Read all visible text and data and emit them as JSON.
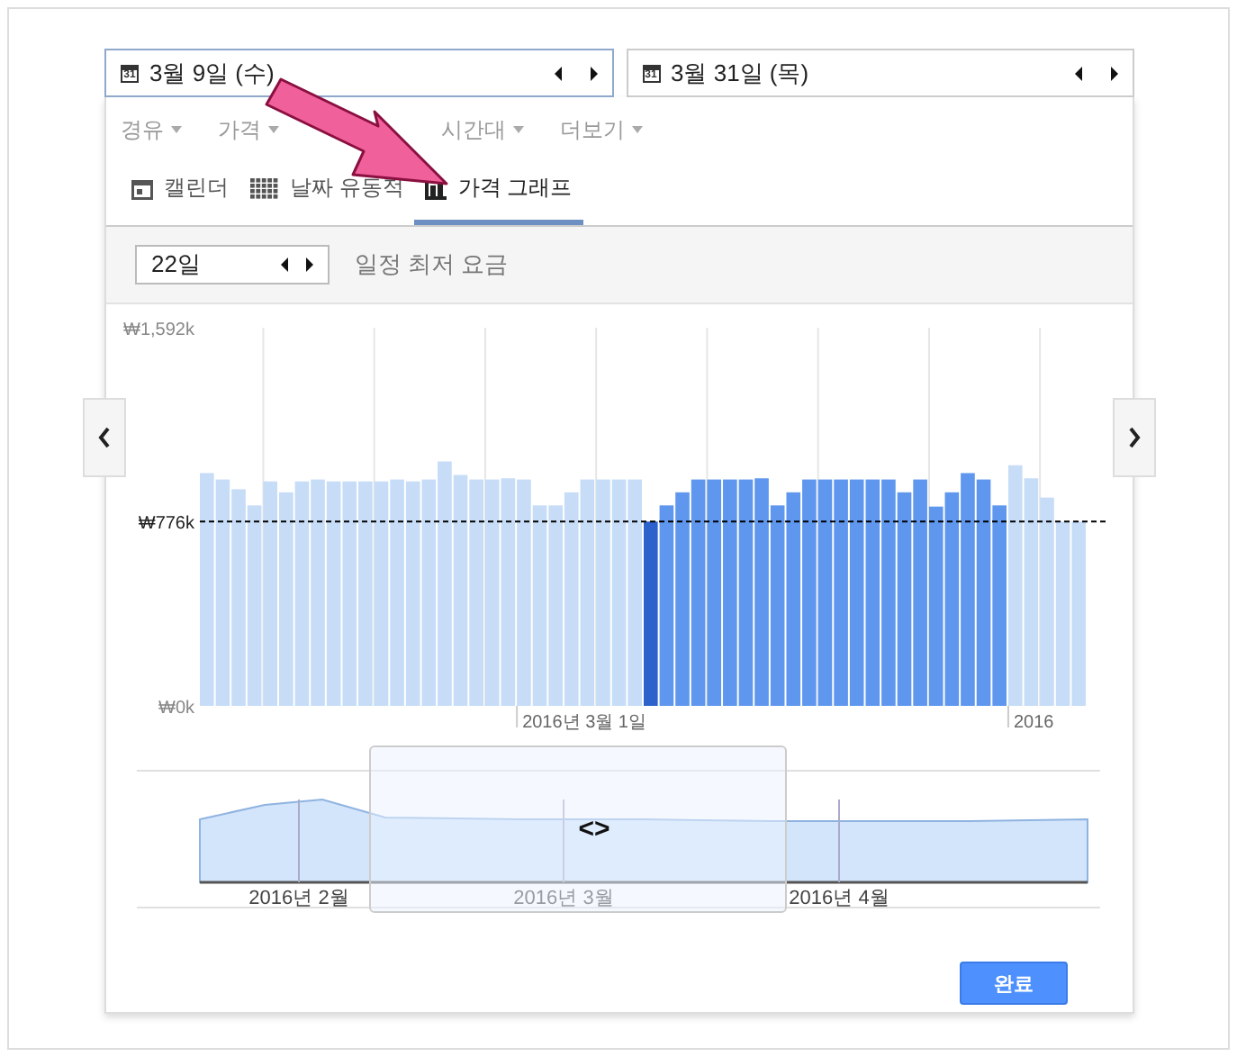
{
  "date_fields": [
    {
      "calendar_icon_day": "31",
      "value": "3월 9일 (수)",
      "focused": true
    },
    {
      "calendar_icon_day": "31",
      "value": "3월 31일 (목)",
      "focused": false
    }
  ],
  "filters": [
    {
      "label": "경유"
    },
    {
      "label": "가격"
    },
    {
      "label": "시간대"
    },
    {
      "label": "더보기"
    }
  ],
  "tabs": [
    {
      "kind": "calendar",
      "label": "캘린더",
      "selected": false
    },
    {
      "kind": "grid",
      "label": "날짜 유동적",
      "selected": false
    },
    {
      "kind": "graph",
      "label": "가격 그래프",
      "selected": true
    }
  ],
  "trip_length": {
    "value": "22일",
    "caption": "일정 최저 요금"
  },
  "chart_data": {
    "type": "bar",
    "stacked": true,
    "ylim": [
      0,
      1592
    ],
    "yticks": [
      {
        "value": 0,
        "label": "₩0k"
      },
      {
        "value": 776,
        "label": "₩776k"
      },
      {
        "value": 1592,
        "label": "₩1,592k"
      }
    ],
    "ref_lines": [
      {
        "axis": "y",
        "value": 776
      }
    ],
    "series": [
      {
        "color": "#c6dcf7",
        "values": [
          980,
          953,
          912,
          844,
          945,
          899,
          945,
          953,
          945,
          945,
          945,
          945,
          953,
          945,
          953,
          1029,
          972,
          953,
          953,
          958,
          953,
          844,
          844,
          899,
          953,
          953,
          953,
          953,
          null,
          null,
          null,
          null,
          null,
          null,
          null,
          null,
          null,
          null,
          null,
          null,
          null,
          null,
          null,
          null,
          null,
          null,
          null,
          null,
          null,
          null,
          null,
          1013,
          958,
          877,
          776,
          776
        ]
      },
      {
        "color": "#2d62cc",
        "values": [
          null,
          null,
          null,
          null,
          null,
          null,
          null,
          null,
          null,
          null,
          null,
          null,
          null,
          null,
          null,
          null,
          null,
          null,
          null,
          null,
          null,
          null,
          null,
          null,
          null,
          null,
          null,
          null,
          776,
          null,
          null,
          null,
          null,
          null,
          null,
          null,
          null,
          null,
          null,
          null,
          null,
          null,
          null,
          null,
          null,
          null,
          null,
          null,
          null,
          null,
          null,
          null,
          null,
          null,
          null,
          null
        ]
      },
      {
        "color": "#5e97ed",
        "values": [
          null,
          null,
          null,
          null,
          null,
          null,
          null,
          null,
          null,
          null,
          null,
          null,
          null,
          null,
          null,
          null,
          null,
          null,
          null,
          null,
          null,
          null,
          null,
          null,
          null,
          null,
          null,
          null,
          null,
          844,
          899,
          953,
          953,
          953,
          953,
          958,
          844,
          899,
          953,
          953,
          953,
          953,
          953,
          953,
          899,
          953,
          839,
          899,
          980,
          953,
          844,
          null,
          null,
          null,
          null,
          null
        ]
      }
    ]
  },
  "chart_axis_labels": [
    "2016년 3월 1일",
    "2016"
  ],
  "overview": {
    "month_labels": [
      "2016년 2월",
      "2016년 3월",
      "2016년 4월"
    ],
    "handle": "<>"
  },
  "done_button": "완료"
}
